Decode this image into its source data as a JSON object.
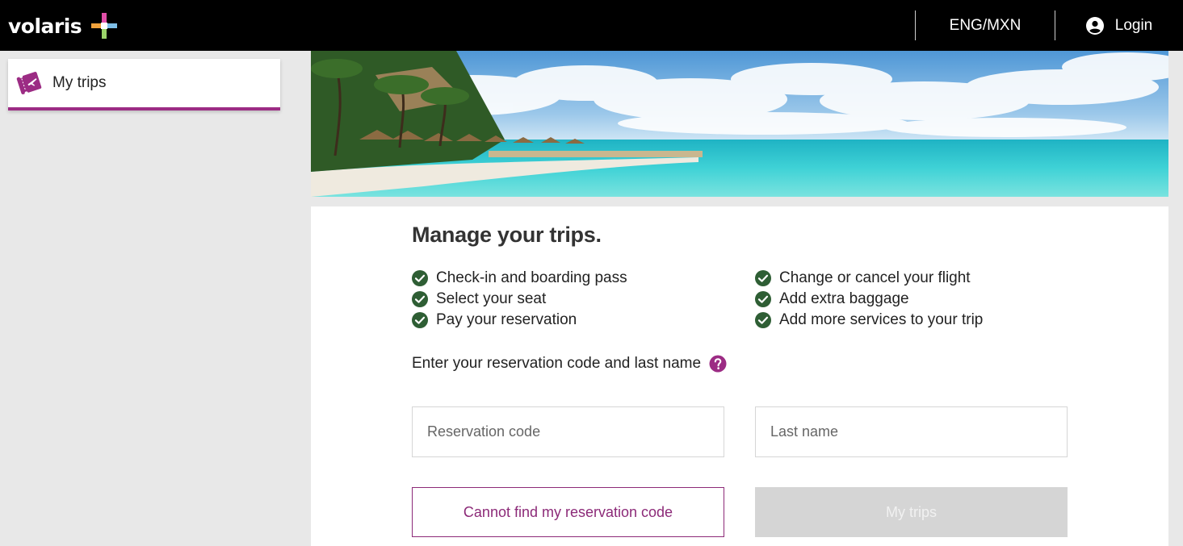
{
  "header": {
    "logo_text": "volaris",
    "language_currency": "ENG/MXN",
    "login_label": "Login"
  },
  "sidebar": {
    "items": [
      {
        "label": "My trips",
        "icon": "ticket-plane-icon"
      }
    ]
  },
  "main": {
    "title": "Manage your trips.",
    "features_left": [
      "Check-in and boarding pass",
      "Select your seat",
      "Pay your reservation"
    ],
    "features_right": [
      "Change or cancel your flight",
      "Add extra baggage",
      "Add more services to your trip"
    ],
    "prompt": "Enter your reservation code and last name",
    "reservation_placeholder": "Reservation code",
    "lastname_placeholder": "Last name",
    "cannot_find_label": "Cannot find my reservation code",
    "submit_label": "My trips"
  },
  "colors": {
    "brand_purple": "#9c2c84",
    "check_green": "#2e5e34",
    "header_bg": "#000000",
    "disabled_button": "#d5d5d5"
  }
}
